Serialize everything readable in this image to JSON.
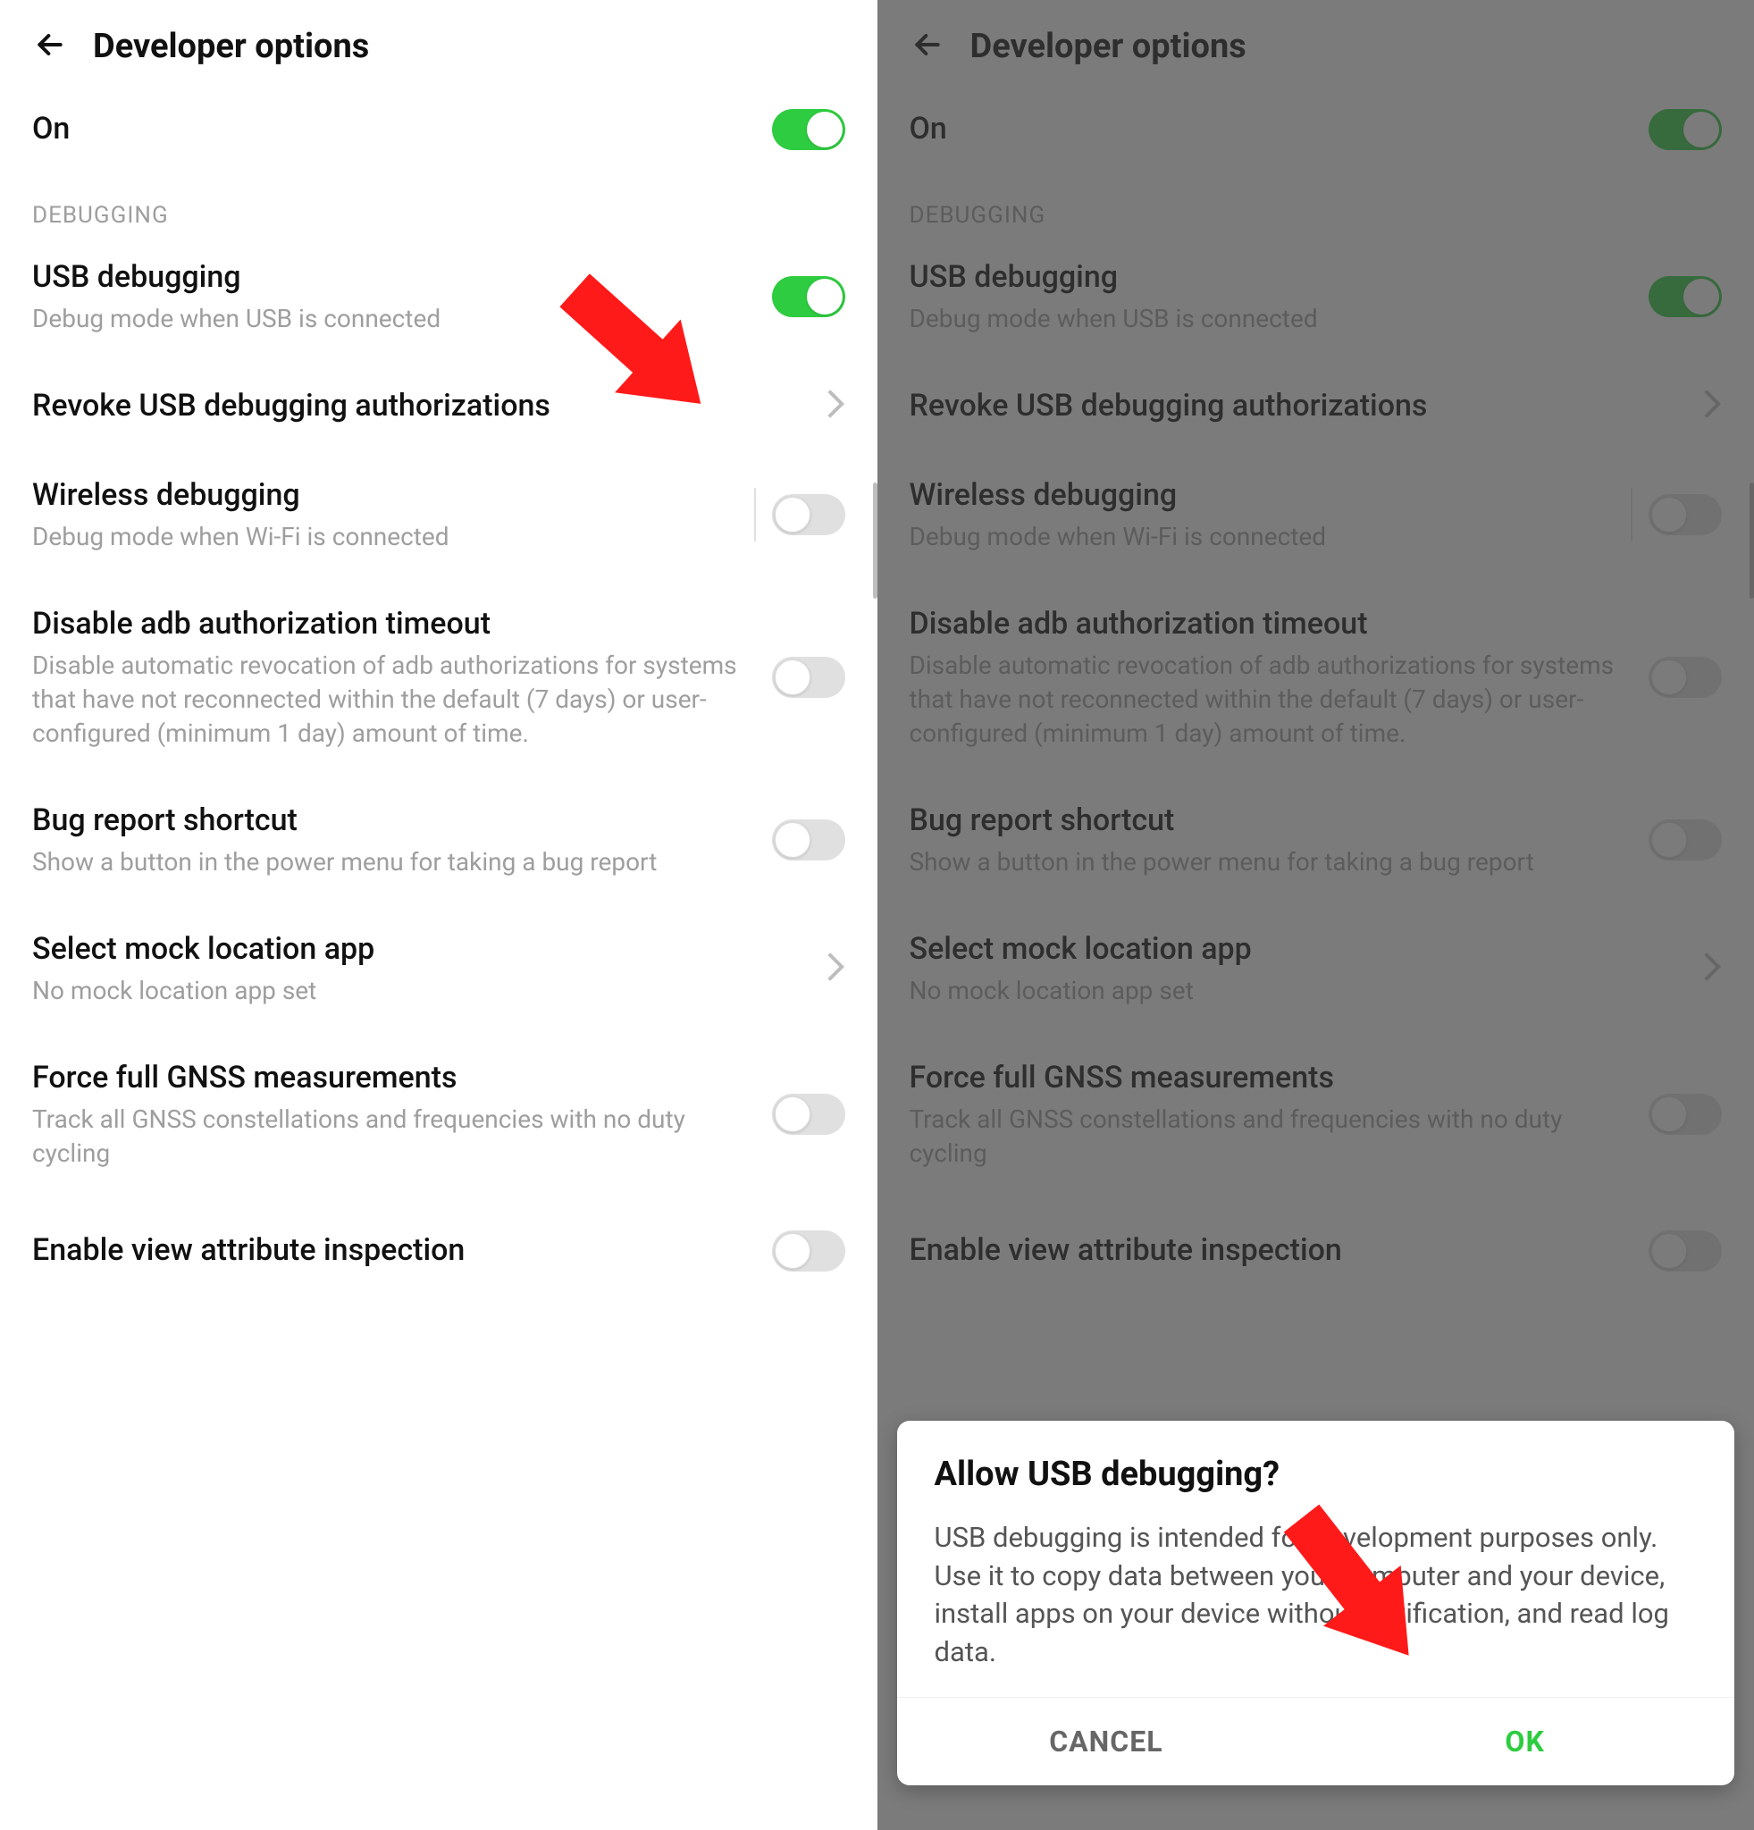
{
  "header": {
    "title": "Developer options"
  },
  "main_toggle": {
    "label": "On"
  },
  "section_debugging": "DEBUGGING",
  "items": {
    "usb": {
      "title": "USB debugging",
      "sub": "Debug mode when USB is connected"
    },
    "revoke": {
      "title": "Revoke USB debugging authorizations"
    },
    "wireless": {
      "title": "Wireless debugging",
      "sub": "Debug mode when Wi-Fi is connected"
    },
    "adb_timeout": {
      "title": "Disable adb authorization timeout",
      "sub": "Disable automatic revocation of adb authorizations for systems that have not reconnected within the default (7 days) or user-configured (minimum 1 day) amount of time."
    },
    "bug_shortcut": {
      "title": "Bug report shortcut",
      "sub": "Show a button in the power menu for taking a bug report"
    },
    "mock_loc": {
      "title": "Select mock location app",
      "sub": "No mock location app set"
    },
    "gnss": {
      "title": "Force full GNSS measurements",
      "sub": "Track all GNSS constellations and frequencies with no duty cycling"
    },
    "view_attr": {
      "title": "Enable view attribute inspection"
    }
  },
  "dialog": {
    "title": "Allow USB debugging?",
    "body": "USB debugging is intended for development purposes only. Use it to copy data between your computer and your device, install apps on your device without notification, and read log data.",
    "cancel": "CANCEL",
    "ok": "OK"
  },
  "colors": {
    "accent": "#2ecc40",
    "arrow": "#ff1a1a"
  }
}
